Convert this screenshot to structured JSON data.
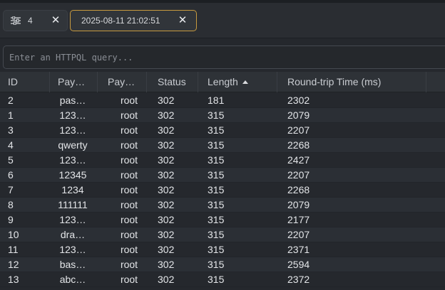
{
  "filter_tab": {
    "count": "4",
    "close": "✕"
  },
  "time_tab": {
    "label": "2025-08-11 21:02:51",
    "close": "✕"
  },
  "query": {
    "placeholder": "Enter an HTTPQL query..."
  },
  "table": {
    "columns": [
      "ID",
      "Pay…",
      "Pay…",
      "Status",
      "Length",
      "Round-trip Time (ms)"
    ],
    "sort": {
      "column": "Length",
      "direction": "ascending"
    },
    "rows": [
      {
        "id": "2",
        "p1": "pas…",
        "p2": "root",
        "status": "302",
        "length": "181",
        "rtt": "2302"
      },
      {
        "id": "1",
        "p1": "123…",
        "p2": "root",
        "status": "302",
        "length": "315",
        "rtt": "2079"
      },
      {
        "id": "3",
        "p1": "123…",
        "p2": "root",
        "status": "302",
        "length": "315",
        "rtt": "2207"
      },
      {
        "id": "4",
        "p1": "qwerty",
        "p2": "root",
        "status": "302",
        "length": "315",
        "rtt": "2268"
      },
      {
        "id": "5",
        "p1": "123…",
        "p2": "root",
        "status": "302",
        "length": "315",
        "rtt": "2427"
      },
      {
        "id": "6",
        "p1": "12345",
        "p2": "root",
        "status": "302",
        "length": "315",
        "rtt": "2207"
      },
      {
        "id": "7",
        "p1": "1234",
        "p2": "root",
        "status": "302",
        "length": "315",
        "rtt": "2268"
      },
      {
        "id": "8",
        "p1": "111111",
        "p2": "root",
        "status": "302",
        "length": "315",
        "rtt": "2079"
      },
      {
        "id": "9",
        "p1": "123…",
        "p2": "root",
        "status": "302",
        "length": "315",
        "rtt": "2177"
      },
      {
        "id": "10",
        "p1": "dra…",
        "p2": "root",
        "status": "302",
        "length": "315",
        "rtt": "2207"
      },
      {
        "id": "11",
        "p1": "123…",
        "p2": "root",
        "status": "302",
        "length": "315",
        "rtt": "2371"
      },
      {
        "id": "12",
        "p1": "bas…",
        "p2": "root",
        "status": "302",
        "length": "315",
        "rtt": "2594"
      },
      {
        "id": "13",
        "p1": "abc…",
        "p2": "root",
        "status": "302",
        "length": "315",
        "rtt": "2372"
      }
    ]
  }
}
